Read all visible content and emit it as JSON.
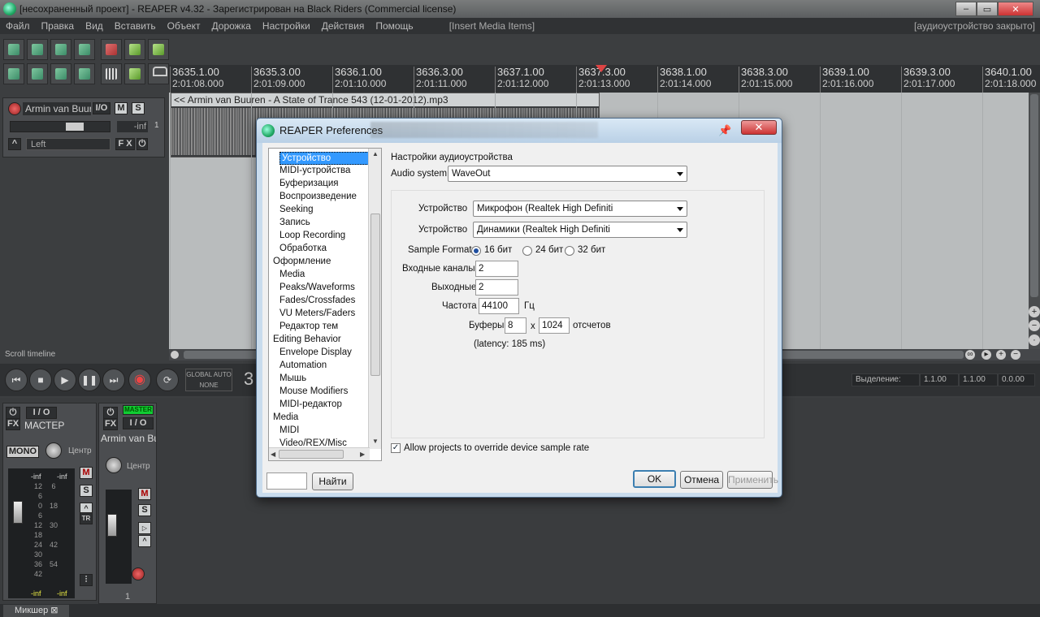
{
  "window": {
    "title": "[несохраненный проект] - REAPER v4.32 - Зарегистрирован на Black Riders (Commercial license)",
    "minimize_label": "‒",
    "maximize_label": "▭",
    "close_label": "✕"
  },
  "menubar": {
    "items": [
      "Файл",
      "Правка",
      "Вид",
      "Вставить",
      "Объект",
      "Дорожка",
      "Настройки",
      "Действия",
      "Помощь"
    ],
    "last_action": "[Insert Media Items]",
    "audio_status": "[аудиоустройство закрыто]"
  },
  "ruler": {
    "marks": [
      {
        "bar": "3635.1.00",
        "time": "2:01:08.000"
      },
      {
        "bar": "3635.3.00",
        "time": "2:01:09.000"
      },
      {
        "bar": "3636.1.00",
        "time": "2:01:10.000"
      },
      {
        "bar": "3636.3.00",
        "time": "2:01:11.000"
      },
      {
        "bar": "3637.1.00",
        "time": "2:01:12.000"
      },
      {
        "bar": "3637.3.00",
        "time": "2:01:13.000"
      },
      {
        "bar": "3638.1.00",
        "time": "2:01:14.000"
      },
      {
        "bar": "3638.3.00",
        "time": "2:01:15.000"
      },
      {
        "bar": "3639.1.00",
        "time": "2:01:16.000"
      },
      {
        "bar": "3639.3.00",
        "time": "2:01:17.000"
      },
      {
        "bar": "3640.1.00",
        "time": "2:01:18.000"
      }
    ]
  },
  "arrange": {
    "item_name": "<< Armin van Buuren - A State of Trance 543 (12-01-2012).mp3",
    "scroll_label": "Scroll timeline"
  },
  "track": {
    "name": "Armin van Buure",
    "io_label": "I/O",
    "mute_label": "M",
    "solo_label": "S",
    "volume_readout": "-inf",
    "number": "1",
    "pan_mode": "Left",
    "fx_label": "F X"
  },
  "transport": {
    "global_auto": "GLOBAL AUTO",
    "global_auto_mode": "NONE",
    "big_time": "3",
    "selection_label": "Выделение:",
    "selection_start": "1.1.00",
    "selection_end": "1.1.00",
    "selection_length": "0.0.00"
  },
  "mixer": {
    "master": {
      "name": "МАСТЕР",
      "io_label": "I / O",
      "fx_label": "FX",
      "mono_label": "MONO",
      "pan_label": "Центр",
      "mute_label": "M",
      "solo_label": "S",
      "tr_label": "TR",
      "peak_left": "-inf",
      "peak_right": "-inf",
      "meter_left_bottom": "-inf",
      "meter_right_bottom": "-inf",
      "scale_left": [
        "12",
        "6",
        "0",
        "6",
        "12",
        "18",
        "24",
        "30",
        "36",
        "42"
      ],
      "scale_right": [
        "6",
        "18",
        "30",
        "42",
        "54"
      ]
    },
    "track": {
      "name": "Armin van Bu",
      "master_send": "MASTER",
      "io_label": "I / O",
      "fx_label": "FX",
      "pan_label": "Центр",
      "mute_label": "M",
      "solo_label": "S",
      "number": "1"
    },
    "tab_label": "Микшер"
  },
  "dialog": {
    "title": "REAPER Preferences",
    "tree": [
      {
        "label": "Устройство",
        "level": 1,
        "selected": true
      },
      {
        "label": "MIDI-устройства",
        "level": 1
      },
      {
        "label": "Буферизация",
        "level": 1
      },
      {
        "label": "Воспроизведение",
        "level": 1
      },
      {
        "label": "Seeking",
        "level": 1
      },
      {
        "label": "Запись",
        "level": 1
      },
      {
        "label": "Loop Recording",
        "level": 1
      },
      {
        "label": "Обработка",
        "level": 1
      },
      {
        "label": "Оформление",
        "level": 0
      },
      {
        "label": "Media",
        "level": 1
      },
      {
        "label": "Peaks/Waveforms",
        "level": 1
      },
      {
        "label": "Fades/Crossfades",
        "level": 1
      },
      {
        "label": "VU Meters/Faders",
        "level": 1
      },
      {
        "label": "Редактор тем",
        "level": 1
      },
      {
        "label": "Editing Behavior",
        "level": 0
      },
      {
        "label": "Envelope Display",
        "level": 1
      },
      {
        "label": "Automation",
        "level": 1
      },
      {
        "label": "Мышь",
        "level": 1
      },
      {
        "label": "Mouse Modifiers",
        "level": 1
      },
      {
        "label": "MIDI-редактор",
        "level": 1
      },
      {
        "label": "Media",
        "level": 0
      },
      {
        "label": "MIDI",
        "level": 1
      },
      {
        "label": "Video/REX/Misc",
        "level": 1
      }
    ],
    "section_title": "Настройки аудиоустройства",
    "audio_system_label": "Audio system:",
    "audio_system_value": "WaveOut",
    "input_device_label": "Устройство",
    "input_device_value": "Микрофон (Realtek High Definiti",
    "output_device_label": "Устройство",
    "output_device_value": "Динамики (Realtek High Definiti",
    "sample_format_label": "Sample Format:",
    "format_options": [
      "16 бит",
      "24 бит",
      "32 бит"
    ],
    "input_channels_label": "Входные каналы:",
    "input_channels_value": "2",
    "output_channels_label": "Выходные",
    "output_channels_value": "2",
    "samplerate_label": "Частота",
    "samplerate_value": "44100",
    "samplerate_unit": "Гц",
    "buffers_label": "Буферы:",
    "buffers_count": "8",
    "buffers_x": "x",
    "buffers_size": "1024",
    "buffers_unit": "отсчетов",
    "latency": "(latency: 185 ms)",
    "override_label": "Allow projects to override device sample rate",
    "find_button": "Найти",
    "ok_button": "OK",
    "cancel_button": "Отмена",
    "apply_button": "Применить"
  }
}
